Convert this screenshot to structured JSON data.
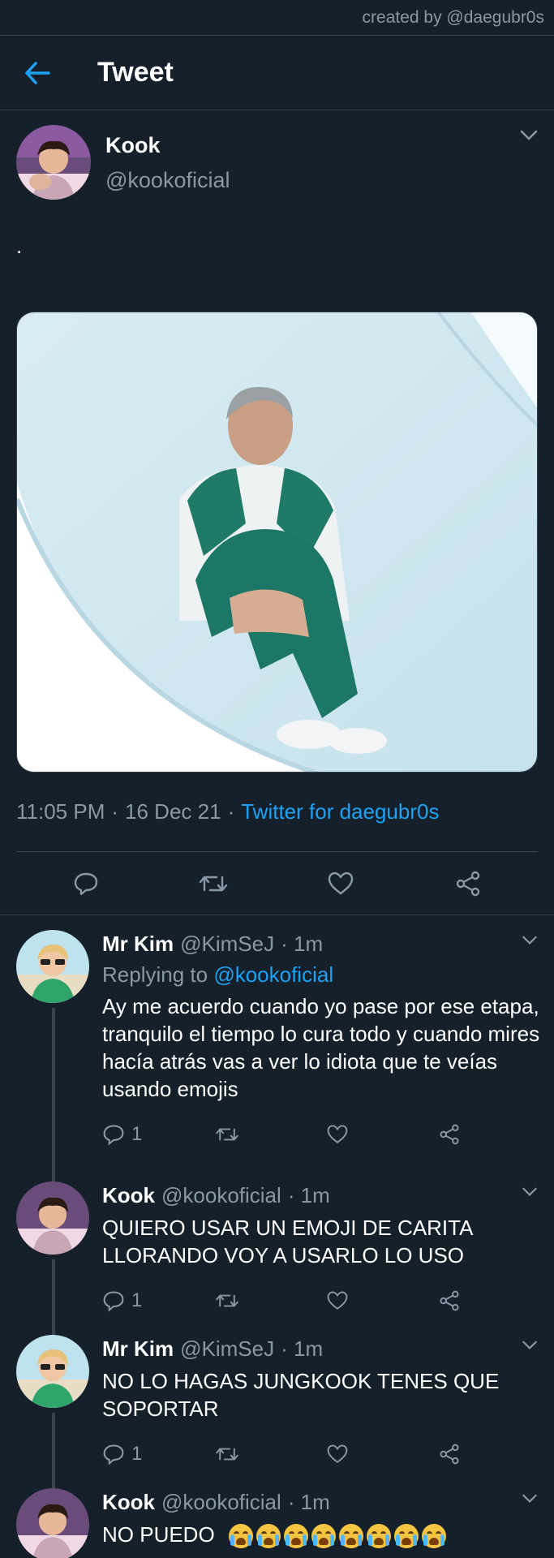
{
  "credit": "created by @daegubr0s",
  "header": {
    "title": "Tweet"
  },
  "tweet": {
    "author_name": "Kook",
    "author_handle": "@kookoficial",
    "text": ".",
    "time": "11:05 PM",
    "date": "16 Dec 21",
    "separator": "·",
    "source": "Twitter for daegubr0s"
  },
  "replies": [
    {
      "name": "Mr Kim",
      "handle": "@KimSeJ",
      "time": "· 1m",
      "replying_label": "Replying to",
      "replying_to": "@kookoficial",
      "text": "Ay me acuerdo cuando yo pase por ese etapa, tranquilo el tiempo lo cura todo y cuando mires hacía atrás vas a ver lo idiota que te veías usando emojis",
      "reply_count": "1"
    },
    {
      "name": "Kook",
      "handle": "@kookoficial",
      "time": "· 1m",
      "text": "QUIERO USAR UN EMOJI DE CARITA LLORANDO VOY A USARLO LO USO",
      "reply_count": "1"
    },
    {
      "name": "Mr Kim",
      "handle": "@KimSeJ",
      "time": "· 1m",
      "text": "NO LO HAGAS JUNGKOOK TENES QUE SOPORTAR",
      "reply_count": "1"
    },
    {
      "name": "Kook",
      "handle": "@kookoficial",
      "time": "· 1m",
      "text": "NO PUEDO",
      "emoji_count": 8,
      "emoji_name": "loudly-crying-face-emoji"
    }
  ],
  "colors": {
    "background": "#15202b",
    "secondary_text": "#8899a6",
    "accent": "#1da1f2",
    "divider": "#38444d"
  },
  "icons": [
    "back-arrow-icon",
    "chevron-down-icon",
    "reply-icon",
    "retweet-icon",
    "like-icon",
    "share-icon"
  ]
}
